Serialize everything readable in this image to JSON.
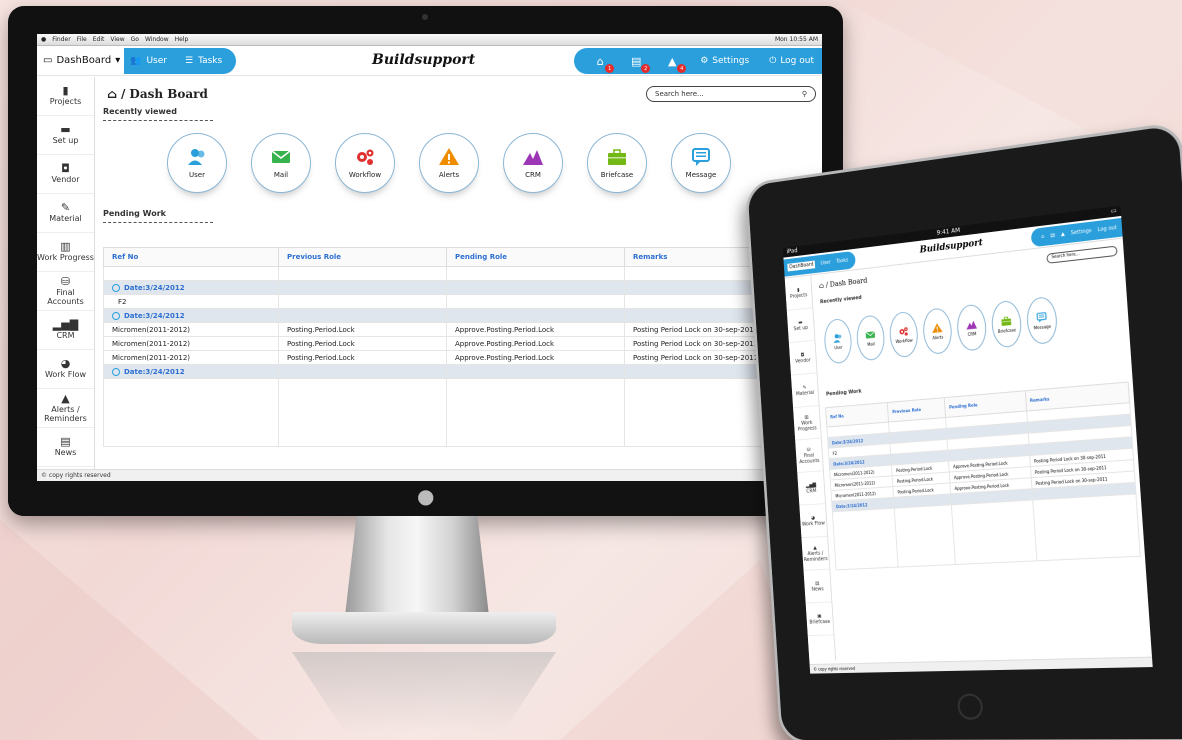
{
  "desktop": {
    "menubar": {
      "items": [
        "Finder",
        "File",
        "Edit",
        "View",
        "Go",
        "Window",
        "Help"
      ],
      "clock": "Mon 10:55 AM"
    },
    "topbar": {
      "dashboard_label": "DashBoard",
      "user_label": "User",
      "tasks_label": "Tasks",
      "logo": "Buildsupport",
      "badges": [
        "1",
        "2",
        "4"
      ],
      "settings_label": "Settings",
      "logout_label": "Log out"
    },
    "sidebar": [
      {
        "label": "Projects",
        "icon": "projects-icon",
        "glyph": "▮"
      },
      {
        "label": "Set up",
        "icon": "setup-icon",
        "glyph": "▬"
      },
      {
        "label": "Vendor",
        "icon": "vendor-icon",
        "glyph": "◘"
      },
      {
        "label": "Material",
        "icon": "pencil-icon",
        "glyph": "✎"
      },
      {
        "label": "Work Progress",
        "icon": "progress-icon",
        "glyph": "▥"
      },
      {
        "label": "Final Accounts",
        "icon": "accounts-icon",
        "glyph": "⛁"
      },
      {
        "label": "CRM",
        "icon": "bar-chart-icon",
        "glyph": "▂▅▇"
      },
      {
        "label": "Work Flow",
        "icon": "pie-chart-icon",
        "glyph": "◕"
      },
      {
        "label": "Alerts / Reminders",
        "icon": "warning-icon",
        "glyph": "▲"
      },
      {
        "label": "News",
        "icon": "news-icon",
        "glyph": "▤"
      },
      {
        "label": "Briefcase",
        "icon": "briefcase-icon",
        "glyph": "▣"
      }
    ],
    "breadcrumb": "Dash Board",
    "search_placeholder": "Search here...",
    "recently_viewed_title": "Recently viewed",
    "recent_items": [
      {
        "label": "User",
        "icon": "user-icon",
        "color": "#2a9fdc"
      },
      {
        "label": "Mail",
        "icon": "mail-icon",
        "color": "#37b24d"
      },
      {
        "label": "Workflow",
        "icon": "gears-icon",
        "color": "#e03131"
      },
      {
        "label": "Alerts",
        "icon": "alert-icon",
        "color": "#f08c00"
      },
      {
        "label": "CRM",
        "icon": "crm-icon",
        "color": "#9c36b5"
      },
      {
        "label": "Briefcase",
        "icon": "briefcase-icon",
        "color": "#74b816"
      },
      {
        "label": "Message",
        "icon": "message-icon",
        "color": "#2a9fdc"
      }
    ],
    "pending_title": "Pending Work",
    "table": {
      "headers": [
        "Ref No",
        "Previous Role",
        "Pending Role",
        "Remarks"
      ],
      "date_label": "Date:3/24/2012",
      "f2": "F2",
      "rows": [
        [
          "Micromen(2011-2012)",
          "Posting.Period.Lock",
          "Approve.Posting.Period.Lock",
          "Posting Period Lock on 30-sep-2011"
        ],
        [
          "Micromen(2011-2012)",
          "Posting.Period.Lock",
          "Approve.Posting.Period.Lock",
          "Posting Period Lock on 30-sep-2011"
        ],
        [
          "Micromen(2011-2012)",
          "Posting.Period.Lock",
          "Approve.Posting.Period.Lock",
          "Posting Period Lock on 30-sep-2011"
        ]
      ]
    },
    "footer": "© copy rights reserved"
  },
  "tablet": {
    "status_left": "iPad",
    "status_time": "9:41 AM",
    "dashboard_label": "DashBoard",
    "user_label": "User",
    "tasks_label": "Tasks",
    "logo": "Buildsupport",
    "settings_label": "Settings",
    "logout_label": "Log out",
    "breadcrumb": "Dash Board",
    "search_placeholder": "Search here...",
    "recently_viewed_title": "Recently viewed",
    "pending_title": "Pending Work",
    "footer": "© copy rights reserved"
  },
  "colors": {
    "accent": "#2a9fdc",
    "header_text": "#2d6fd1",
    "date_row_bg": "#dfe6ee",
    "badge": "#e52b2b"
  }
}
